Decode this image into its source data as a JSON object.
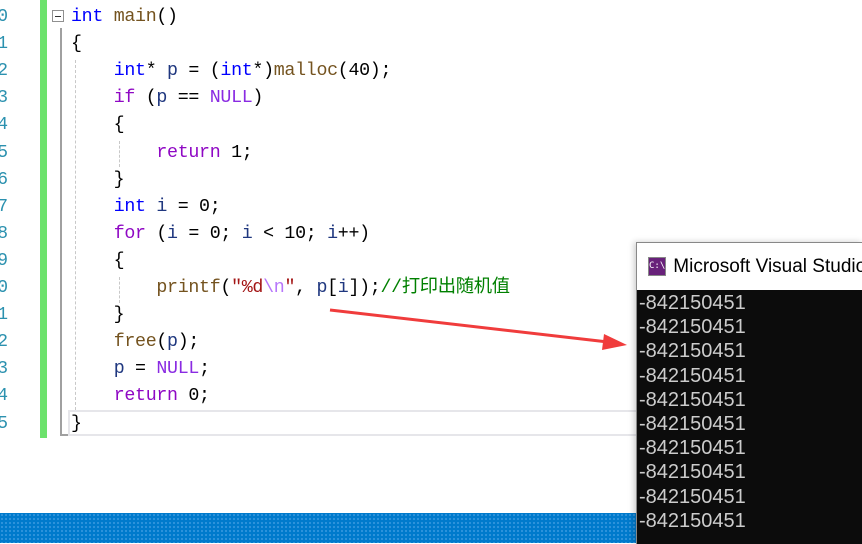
{
  "editor": {
    "line_numbers": [
      "0",
      "1",
      "2",
      "3",
      "4",
      "5",
      "6",
      "7",
      "8",
      "9",
      "0",
      "1",
      "2",
      "3",
      "4",
      "5"
    ],
    "lines": [
      [
        {
          "t": "int",
          "c": "kw"
        },
        {
          "t": " ",
          "c": "pn"
        },
        {
          "t": "main",
          "c": "fn"
        },
        {
          "t": "()",
          "c": "pn"
        }
      ],
      [
        {
          "t": "{",
          "c": "pn"
        }
      ],
      [
        {
          "t": "    ",
          "c": "pn"
        },
        {
          "t": "int",
          "c": "kw"
        },
        {
          "t": "* ",
          "c": "pn"
        },
        {
          "t": "p",
          "c": "var"
        },
        {
          "t": " = (",
          "c": "pn"
        },
        {
          "t": "int",
          "c": "kw"
        },
        {
          "t": "*)",
          "c": "pn"
        },
        {
          "t": "malloc",
          "c": "fn"
        },
        {
          "t": "(40);",
          "c": "pn"
        }
      ],
      [
        {
          "t": "    ",
          "c": "pn"
        },
        {
          "t": "if",
          "c": "ctl"
        },
        {
          "t": " (",
          "c": "pn"
        },
        {
          "t": "p",
          "c": "var"
        },
        {
          "t": " == ",
          "c": "pn"
        },
        {
          "t": "NULL",
          "c": "mac"
        },
        {
          "t": ")",
          "c": "pn"
        }
      ],
      [
        {
          "t": "    {",
          "c": "pn"
        }
      ],
      [
        {
          "t": "        ",
          "c": "pn"
        },
        {
          "t": "return",
          "c": "ctl"
        },
        {
          "t": " 1;",
          "c": "pn"
        }
      ],
      [
        {
          "t": "    }",
          "c": "pn"
        }
      ],
      [
        {
          "t": "    ",
          "c": "pn"
        },
        {
          "t": "int",
          "c": "kw"
        },
        {
          "t": " ",
          "c": "pn"
        },
        {
          "t": "i",
          "c": "var"
        },
        {
          "t": " = 0;",
          "c": "pn"
        }
      ],
      [
        {
          "t": "    ",
          "c": "pn"
        },
        {
          "t": "for",
          "c": "ctl"
        },
        {
          "t": " (",
          "c": "pn"
        },
        {
          "t": "i",
          "c": "var"
        },
        {
          "t": " = 0; ",
          "c": "pn"
        },
        {
          "t": "i",
          "c": "var"
        },
        {
          "t": " < 10; ",
          "c": "pn"
        },
        {
          "t": "i",
          "c": "var"
        },
        {
          "t": "++)",
          "c": "pn"
        }
      ],
      [
        {
          "t": "    {",
          "c": "pn"
        }
      ],
      [
        {
          "t": "        ",
          "c": "pn"
        },
        {
          "t": "printf",
          "c": "fn"
        },
        {
          "t": "(",
          "c": "pn"
        },
        {
          "t": "\"%d",
          "c": "str"
        },
        {
          "t": "\\n",
          "c": "esc"
        },
        {
          "t": "\"",
          "c": "str"
        },
        {
          "t": ", ",
          "c": "pn"
        },
        {
          "t": "p",
          "c": "var"
        },
        {
          "t": "[",
          "c": "pn"
        },
        {
          "t": "i",
          "c": "var"
        },
        {
          "t": "]);",
          "c": "pn"
        },
        {
          "t": "//打印出随机值",
          "c": "cmt"
        }
      ],
      [
        {
          "t": "    }",
          "c": "pn"
        }
      ],
      [
        {
          "t": "    ",
          "c": "pn"
        },
        {
          "t": "free",
          "c": "fn"
        },
        {
          "t": "(",
          "c": "pn"
        },
        {
          "t": "p",
          "c": "var"
        },
        {
          "t": ");",
          "c": "pn"
        }
      ],
      [
        {
          "t": "    ",
          "c": "pn"
        },
        {
          "t": "p",
          "c": "var"
        },
        {
          "t": " = ",
          "c": "pn"
        },
        {
          "t": "NULL",
          "c": "mac"
        },
        {
          "t": ";",
          "c": "pn"
        }
      ],
      [
        {
          "t": "    ",
          "c": "pn"
        },
        {
          "t": "return",
          "c": "ctl"
        },
        {
          "t": " 0;",
          "c": "pn"
        }
      ],
      [
        {
          "t": "}",
          "c": "pn"
        }
      ]
    ]
  },
  "console": {
    "title": "Microsoft Visual Studio Debug Console",
    "icon_label": "C:\\",
    "icon": "console-icon",
    "output": [
      "-842150451",
      "-842150451",
      "-842150451",
      "-842150451",
      "-842150451",
      "-842150451",
      "-842150451",
      "-842150451",
      "-842150451",
      "-842150451"
    ]
  },
  "colors": {
    "arrow": "#f03c3c",
    "status_bar": "#007acc",
    "change_bar": "#6ce26c"
  }
}
